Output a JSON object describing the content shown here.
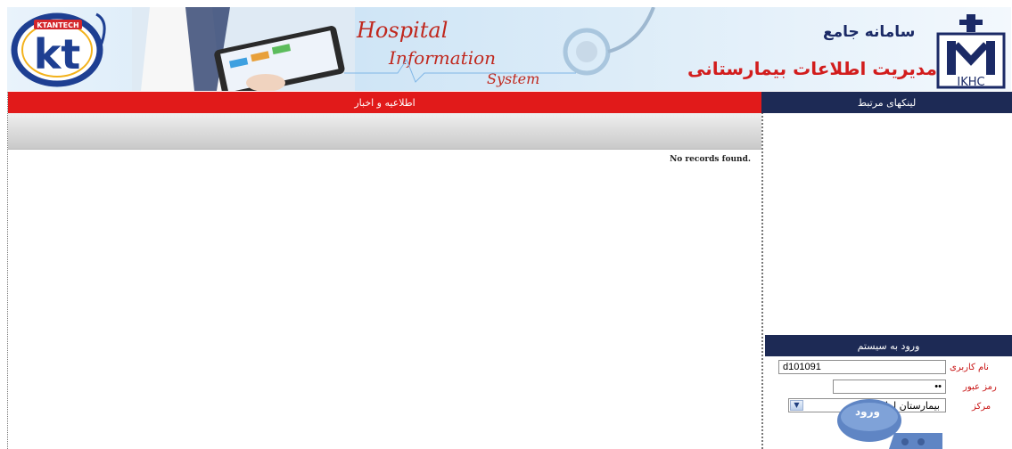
{
  "banner": {
    "kt_brand": "KTANTECH",
    "kt_letters": "kt",
    "hospital_title": [
      "Hospital",
      "Information",
      "System"
    ],
    "brand_line1": "سامانه جامع",
    "brand_line2": "مدیریت اطلاعات بیمارستانی",
    "ikhc": "IKHC"
  },
  "main": {
    "header": "اطلاعیه و اخبار",
    "empty_text": "No records found."
  },
  "sidebar": {
    "links_header": "لینکهای مرتبط",
    "login_header": "ورود به سیستم",
    "username_label": "نام کاربری",
    "username_value": "d101091",
    "password_label": "رمز عبور",
    "password_value": "••",
    "center_label": "مرکز",
    "center_value": "بیمارستان امام خمینی",
    "login_button": "ورود"
  },
  "colors": {
    "red": "#e11a1a",
    "navy": "#1d2a55",
    "label_red": "#c81414"
  }
}
